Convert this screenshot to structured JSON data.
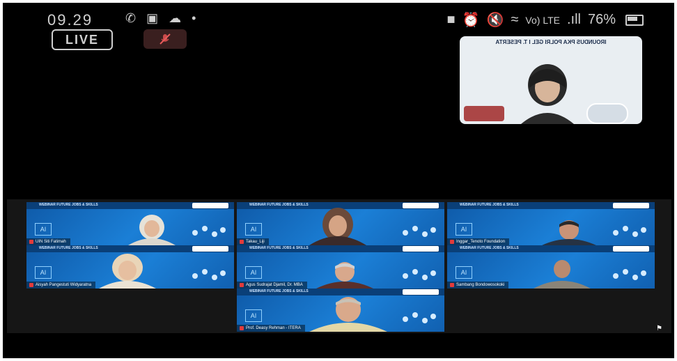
{
  "status_bar": {
    "time": "09.29",
    "left_icons": [
      "whatsapp-icon",
      "gallery-icon",
      "cloud-icon",
      "dot-icon"
    ],
    "right_icons": [
      "camera-icon",
      "alarm-icon",
      "mute-icon",
      "wifi-icon"
    ],
    "network_label": "Vo) LTE",
    "signal": ".ıll",
    "battery_percent": "76%"
  },
  "live_label": "LIVE",
  "pip": {
    "banner": "IROUNDUS PKA POLRI GEL I T.\nPESERTA"
  },
  "participants": [
    {
      "name": "UIN Siti Fatimah",
      "bg": "#1b7fd6"
    },
    {
      "name": "Takau_Liji",
      "bg": "#1b7fd6"
    },
    {
      "name": "Inggar_Tenoto Foundation",
      "bg": "#1b7fd6"
    },
    {
      "name": "Aisyah Pangestuti Widyaratna",
      "bg": "#1b7fd6"
    },
    {
      "name": "Agus Sudrajat Djamil, Dr. MBA",
      "bg": "#1b7fd6"
    },
    {
      "name": "Sambang Bondowosokoki",
      "bg": "#1b7fd6"
    },
    {
      "name": "Prof. Deasy Rehman - ITERA",
      "bg": "#1b7fd6"
    }
  ],
  "tile_header_text": "WEBINAR FUTURE JOBS & SKILLS",
  "colors": {
    "tile_blue": "#1b7fd6",
    "tile_header": "#0a3f78",
    "mic_red": "#e23b3b"
  }
}
